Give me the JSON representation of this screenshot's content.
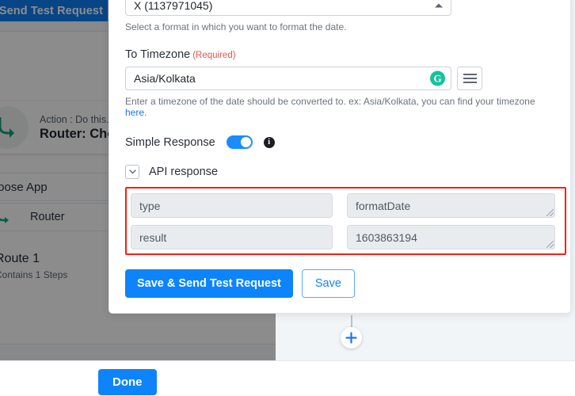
{
  "background": {
    "top_button_label": "Save & Send Test Request",
    "action_card": {
      "subtitle": "Action : Do this...",
      "title": "Router: Choose App"
    },
    "rows": {
      "choose_app": "Choose App",
      "router": "Router"
    },
    "route": {
      "title": "Route 1",
      "subtitle": "Contains 1 Steps"
    }
  },
  "panel": {
    "format_select": {
      "value": "X (1137971045)",
      "caret": "caret-up-icon",
      "hint": "Select a format in which you want to format the date."
    },
    "timezone": {
      "label": "To Timezone",
      "required_tag": "(Required)",
      "value": "Asia/Kolkata",
      "grammarly_badge": "G",
      "hint_before_link": "Enter a timezone of the date should be converted to. ex: Asia/Kolkata, you can find your timezone ",
      "hint_link": "here",
      "hint_after_link": "."
    },
    "simple_response": {
      "label": "Simple Response",
      "toggle_state": "on",
      "info_icon": "info-icon"
    },
    "api_response": {
      "label": "API response",
      "collapse_icon": "chevron-down-icon",
      "rows": [
        {
          "key": "type",
          "value": "formatDate"
        },
        {
          "key": "result",
          "value": "1603863194"
        }
      ],
      "highlight_color": "#fa1e0e"
    },
    "buttons": {
      "primary": "Save & Send Test Request",
      "secondary": "Save"
    }
  },
  "canvas": {
    "add_step_icon": "plus-icon"
  },
  "footer": {
    "done_label": "Done"
  },
  "colors": {
    "accent_blue": "#0d84fc",
    "required_red": "#e2574c",
    "highlight_red": "#fa1e0e",
    "grammarly_green": "#15c39a",
    "canvas_bg": "#f2f5f8"
  }
}
